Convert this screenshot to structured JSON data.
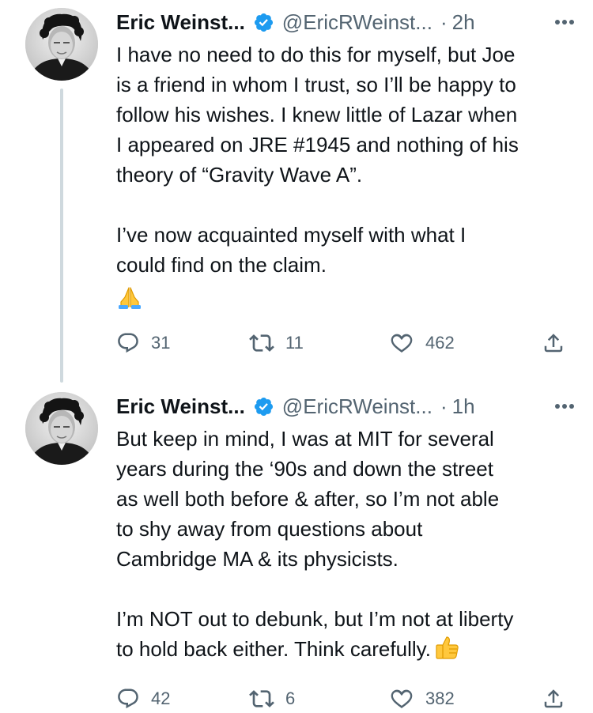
{
  "thread": {
    "tweets": [
      {
        "display_name": "Eric Weinst...",
        "handle": "@EricRWeinst...",
        "separator": "·",
        "time": "2h",
        "lines": [
          "I have no need to do this for myself, but Joe",
          "is a friend in whom I trust, so I’ll be happy to",
          "follow his wishes. I knew little of Lazar when",
          "I appeared on JRE #1945 and nothing of his",
          "theory of “Gravity Wave A”.",
          "",
          "I’ve now acquainted myself with what I",
          "could find on the claim."
        ],
        "trailing_emoji": "folded-hands-emoji",
        "reply_count": "31",
        "retweet_count": "11",
        "like_count": "462"
      },
      {
        "display_name": "Eric Weinst...",
        "handle": "@EricRWeinst...",
        "separator": "·",
        "time": "1h",
        "lines": [
          "But keep in mind, I was at MIT for several",
          "years during the ‘90s and down the street",
          "as well both before & after, so I’m not able",
          "to shy away from questions about",
          "Cambridge MA & its physicists.",
          "",
          "I’m NOT out to debunk, but I’m not at liberty",
          "to hold back either. Think carefully."
        ],
        "trailing_emoji": "thumbs-up-emoji",
        "reply_count": "42",
        "retweet_count": "6",
        "like_count": "382"
      }
    ]
  },
  "colors": {
    "text_primary": "#0f1419",
    "text_secondary": "#536471",
    "verified_blue": "#1d9bf0",
    "thread_line": "#cfd9de"
  },
  "icons": [
    "verified-badge-icon",
    "more-icon",
    "reply-icon",
    "retweet-icon",
    "like-icon",
    "share-icon"
  ]
}
